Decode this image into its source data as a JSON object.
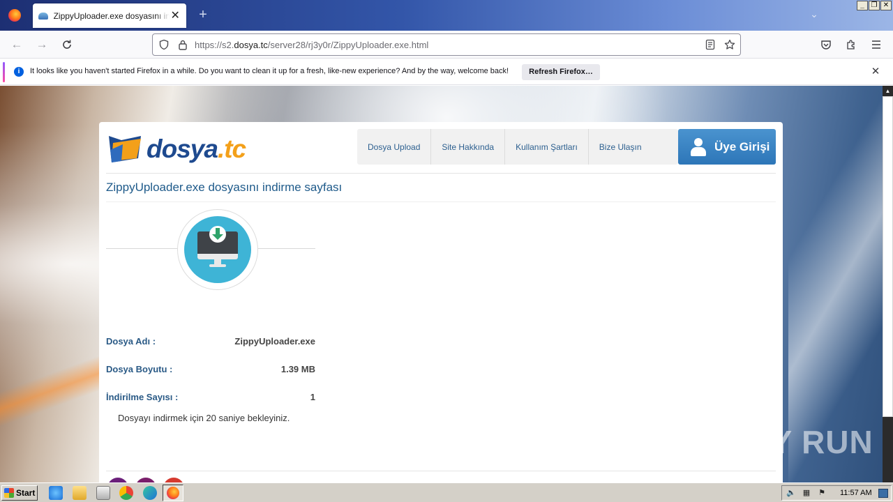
{
  "browser": {
    "tab": {
      "title": "ZippyUploader.exe dosyasını indirme sayfası"
    },
    "url": {
      "prefix": "https://s2.",
      "host": "dosya.tc",
      "path": "/server28/rj3y0r/ZippyUploader.exe.html"
    },
    "notification": {
      "message": "It looks like you haven't started Firefox in a while. Do you want to clean it up for a fresh, like-new experience? And by the way, welcome back!",
      "button_label": "Refresh Firefox…"
    }
  },
  "site": {
    "logo": {
      "part1": "dosya",
      "part2": ".tc"
    },
    "nav": [
      {
        "label": "Dosya Upload"
      },
      {
        "label": "Site Hakkında"
      },
      {
        "label": "Kullanım Şartları"
      },
      {
        "label": "Bize Ulaşın"
      }
    ],
    "login_label": "Üye Girişi",
    "page_title": "ZippyUploader.exe dosyasını indirme sayfası",
    "file_info": [
      {
        "label": "Dosya Adı :",
        "value": "ZippyUploader.exe"
      },
      {
        "label": "Dosya Boyutu :",
        "value": "1.39 MB"
      },
      {
        "label": "İndirilme Sayısı :",
        "value": "1"
      }
    ],
    "wait_message": "Dosyayı indirmek için 20 saniye bekleyiniz.",
    "colors": {
      "accent": "#2d76b8",
      "title": "#1e5a8a",
      "download_circle": "#3eb4d6",
      "logo_blue": "#1e4a8f",
      "logo_orange": "#f3a01a"
    }
  },
  "watermark": "ANY RUN",
  "taskbar": {
    "start_label": "Start",
    "clock": "11:57 AM"
  }
}
